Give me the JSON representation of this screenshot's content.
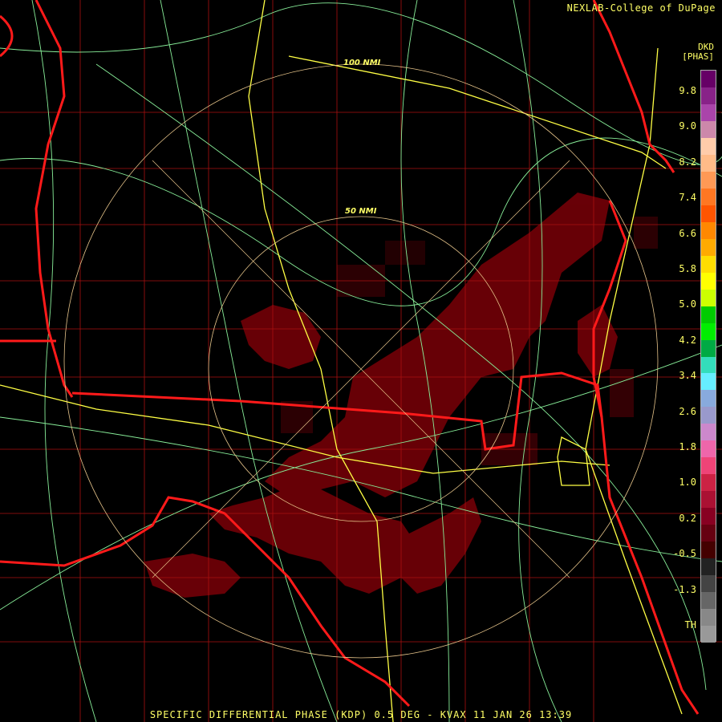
{
  "header": {
    "credit": "NEXLAB-College of DuPage",
    "product_code": "DKD",
    "product_unit": "[PHAS]"
  },
  "footer": {
    "title": "SPECIFIC DIFFERENTIAL PHASE (KDP) 0.5 DEG - KVAX 11 JAN 26 13:39"
  },
  "range_rings": [
    {
      "label": "50 NMI"
    },
    {
      "label": "100 NMI"
    }
  ],
  "color_scale": {
    "ticks": [
      "9.8",
      "9.0",
      "8.2",
      "7.4",
      "6.6",
      "5.8",
      "5.0",
      "4.2",
      "3.4",
      "2.6",
      "1.8",
      "1.0",
      "0.2",
      "-0.5",
      "-1.3",
      "TH"
    ],
    "colors": [
      "#660066",
      "#882288",
      "#aa44aa",
      "#cc88aa",
      "#ffccaa",
      "#ffbb88",
      "#ff9955",
      "#ff7722",
      "#ff5500",
      "#ff8800",
      "#ffaa00",
      "#ffdd00",
      "#ffff00",
      "#ccff00",
      "#00cc00",
      "#00ee00",
      "#00aa44",
      "#33ddbb",
      "#66eeff",
      "#88aadd",
      "#9999cc",
      "#cc88cc",
      "#ee66aa",
      "#ee4477",
      "#cc2244",
      "#aa1133",
      "#880022",
      "#660011",
      "#440000",
      "#222222",
      "#444444",
      "#666666",
      "#888888",
      "#999999"
    ],
    "highlight": "#880000"
  }
}
